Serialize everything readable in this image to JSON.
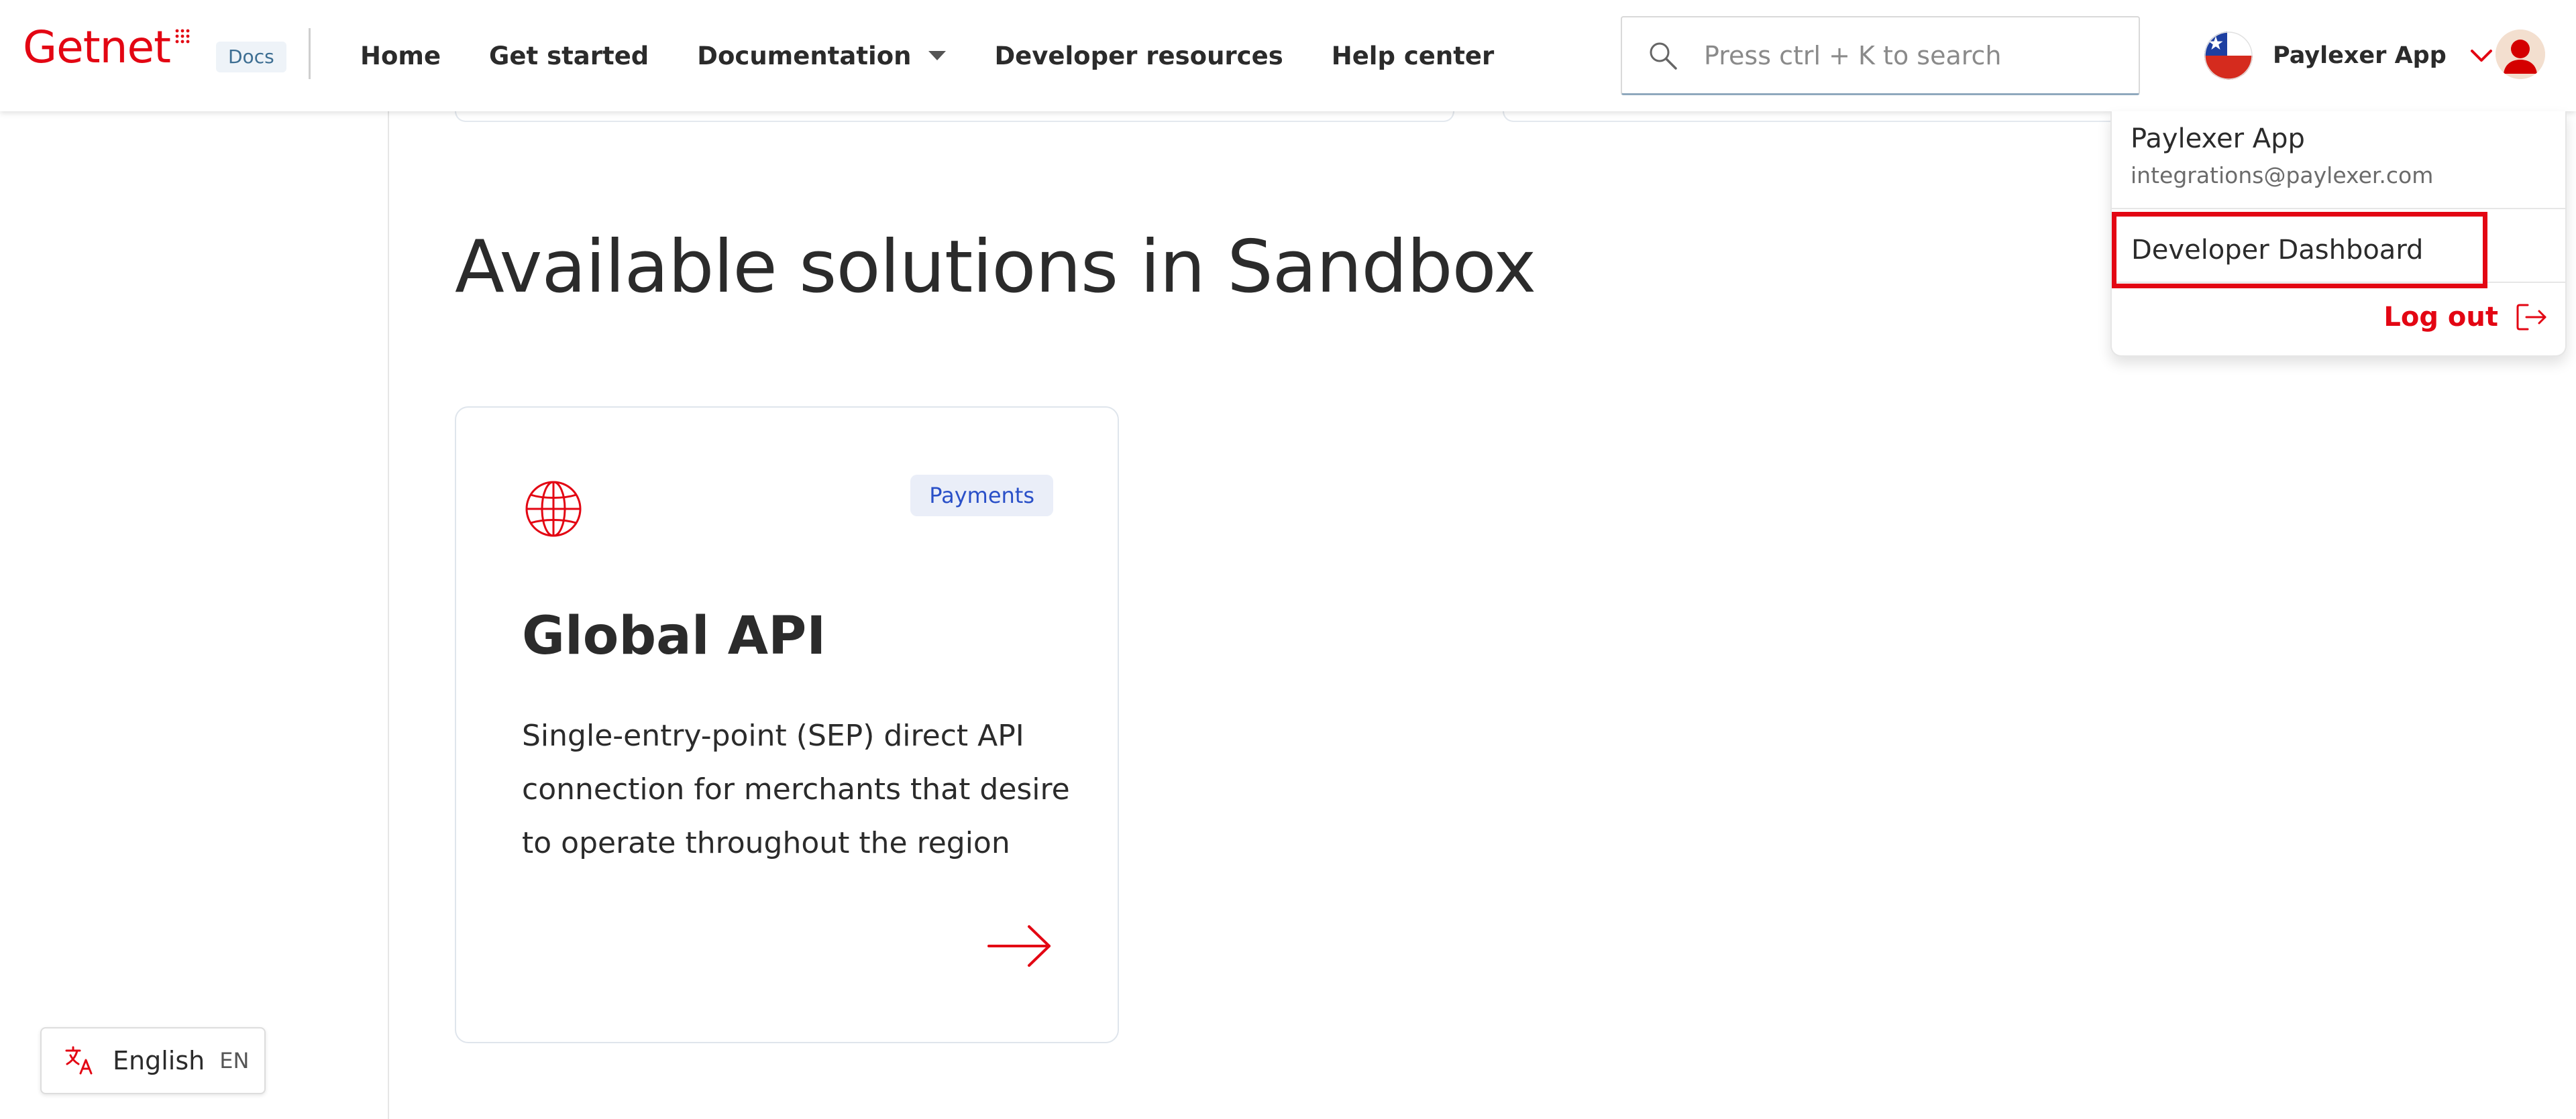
{
  "header": {
    "logo_text": "Getnet",
    "docs_badge": "Docs",
    "nav": [
      {
        "label": "Home"
      },
      {
        "label": "Get started"
      },
      {
        "label": "Documentation"
      },
      {
        "label": "Developer resources"
      },
      {
        "label": "Help center"
      }
    ],
    "search": {
      "placeholder": "Press ctrl + K to search"
    },
    "account": {
      "name": "Paylexer App",
      "flag": "flag-chile-icon"
    },
    "avatar": "user-avatar-icon"
  },
  "sidebar": {
    "language": {
      "name": "English",
      "code": "EN"
    }
  },
  "main": {
    "section_title": "Available solutions in Sandbox",
    "cards": [
      {
        "icon": "globe-icon",
        "tag": "Payments",
        "title": "Global API",
        "description": "Single-entry-point (SEP) direct API connection for merchants that desire to operate throughout the region"
      }
    ]
  },
  "dropdown": {
    "name": "Paylexer App",
    "email": "integrations@paylexer.com",
    "items": [
      {
        "label": "Developer Dashboard"
      }
    ],
    "logout_label": "Log out"
  },
  "colors": {
    "brand_red": "#e30613",
    "tag_bg": "#eaeef8",
    "tag_text": "#2a50c8",
    "docs_badge_text": "#3d6e92"
  }
}
